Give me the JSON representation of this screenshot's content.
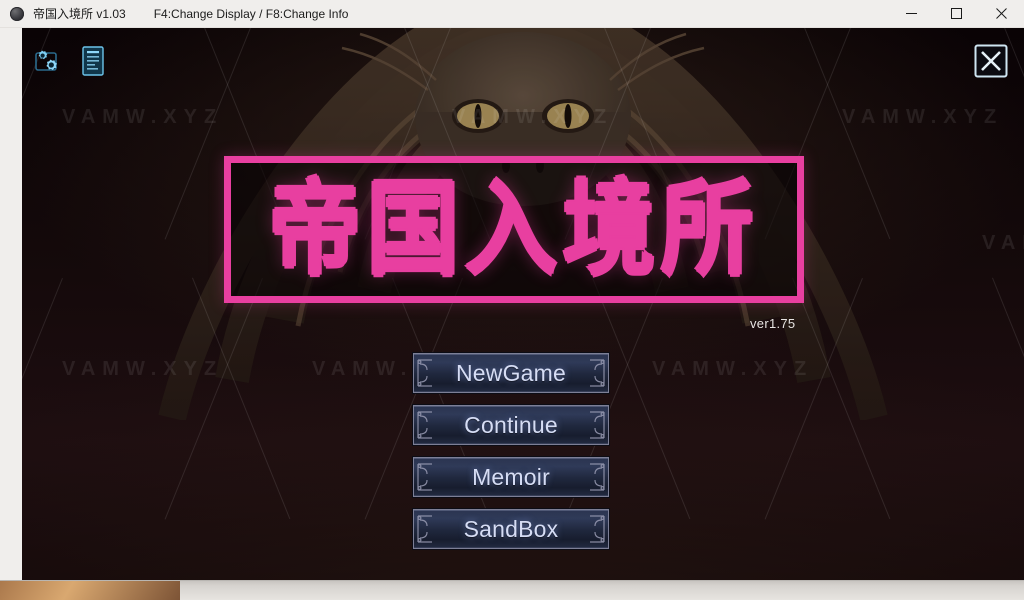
{
  "window": {
    "app_icon": "sphere-icon",
    "title": "帝国入境所 v1.03",
    "hint": "F4:Change Display / F8:Change Info",
    "controls": {
      "minimize": "minimize-icon",
      "maximize": "maximize-icon",
      "close": "close-icon"
    }
  },
  "game": {
    "logo_text": "帝国入境所",
    "version": "ver1.75",
    "tools": [
      {
        "name": "settings-gears-icon",
        "label": "Settings"
      },
      {
        "name": "document-icon",
        "label": "Info"
      }
    ],
    "exit_button": "exit-x-icon",
    "menu": [
      {
        "id": "newgame",
        "label": "NewGame"
      },
      {
        "id": "continue",
        "label": "Continue"
      },
      {
        "id": "memoir",
        "label": "Memoir"
      },
      {
        "id": "sandbox",
        "label": "SandBox"
      }
    ],
    "watermark": "VAMW.XYZ",
    "colors": {
      "logo_pink": "#e83fa0",
      "button_text": "#d6ddf5",
      "background": "#0b0406",
      "titlebar": "#f0eeec"
    }
  }
}
